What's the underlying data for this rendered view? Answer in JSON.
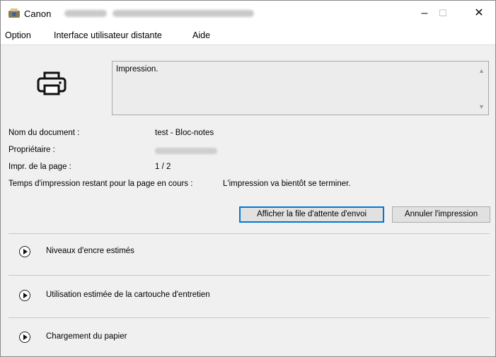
{
  "window": {
    "title": "Canon",
    "minimize": "–",
    "maximize": "☐",
    "close": "✕"
  },
  "menu": [
    {
      "label": "Option"
    },
    {
      "label": "Interface utilisateur distante"
    },
    {
      "label": "Aide"
    }
  ],
  "status": {
    "message": "Impression."
  },
  "info": {
    "document_label": "Nom du document :",
    "document_value": "test - Bloc-notes",
    "owner_label": "Propriétaire :",
    "page_label": "Impr. de la page :",
    "page_value": "1 / 2",
    "time_label": "Temps d'impression restant pour la page en cours :",
    "time_value": "L'impression va bientôt se terminer."
  },
  "buttons": {
    "queue": "Afficher la file d'attente d'envoi",
    "cancel": "Annuler l'impression"
  },
  "sections": [
    {
      "label": "Niveaux d'encre estimés"
    },
    {
      "label": "Utilisation estimée de la cartouche d'entretien"
    },
    {
      "label": "Chargement du papier"
    }
  ],
  "colors": {
    "focus_border": "#0078d7",
    "window_bg": "#f0f0f0"
  }
}
